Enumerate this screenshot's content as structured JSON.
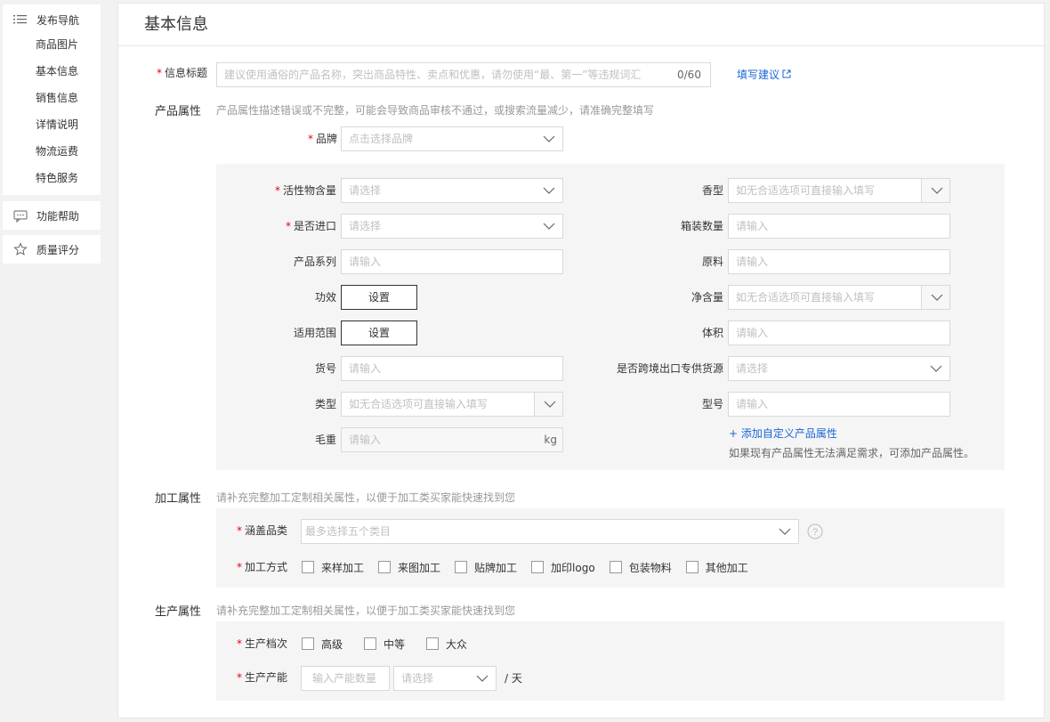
{
  "sidebar": {
    "head": "发布导航",
    "items": [
      "商品图片",
      "基本信息",
      "销售信息",
      "详情说明",
      "物流运费",
      "特色服务"
    ],
    "help": "功能帮助",
    "quality": "质量评分"
  },
  "main": {
    "title": "基本信息",
    "info_title": {
      "label": "信息标题",
      "placeholder": "建议使用通俗的产品名称，突出商品特性、卖点和优惠，请勿使用“最、第一”等违规词汇",
      "count": "0/60",
      "suggest": "填写建议"
    },
    "product_attr": {
      "title": "产品属性",
      "hint": "产品属性描述错误或不完整，可能会导致商品审核不通过，或搜索流量减少，请准确完整填写",
      "brand_label": "品牌",
      "brand_placeholder": "点击选择品牌",
      "left": {
        "active": {
          "label": "活性物含量",
          "placeholder": "请选择"
        },
        "import": {
          "label": "是否进口",
          "placeholder": "请选择"
        },
        "series": {
          "label": "产品系列",
          "placeholder": "请输入"
        },
        "effect": {
          "label": "功效",
          "button": "设置"
        },
        "scope": {
          "label": "适用范围",
          "button": "设置"
        },
        "item_no": {
          "label": "货号",
          "placeholder": "请输入"
        },
        "type": {
          "label": "类型",
          "placeholder": "如无合适选项可直接输入填写"
        },
        "gross": {
          "label": "毛重",
          "placeholder": "请输入",
          "unit": "kg"
        }
      },
      "right": {
        "fragrance": {
          "label": "香型",
          "placeholder": "如无合适选项可直接输入填写"
        },
        "box_qty": {
          "label": "箱装数量",
          "placeholder": "请输入"
        },
        "material": {
          "label": "原料",
          "placeholder": "请输入"
        },
        "net": {
          "label": "净含量",
          "placeholder": "如无合适选项可直接输入填写"
        },
        "volume": {
          "label": "体积",
          "placeholder": "请输入"
        },
        "cross_border": {
          "label": "是否跨境出口专供货源",
          "placeholder": "请选择"
        },
        "model": {
          "label": "型号",
          "placeholder": "请输入"
        },
        "add_custom": "+ 添加自定义产品属性",
        "add_hint": "如果现有产品属性无法满足需求，可添加产品属性。"
      }
    },
    "process_attr": {
      "title": "加工属性",
      "hint": "请补充完整加工定制相关属性，以便于加工类买家能快速找到您",
      "category_label": "涵盖品类",
      "category_placeholder": "最多选择五个类目",
      "method_label": "加工方式",
      "methods": [
        "来样加工",
        "来图加工",
        "贴牌加工",
        "加印logo",
        "包装物料",
        "其他加工"
      ]
    },
    "production_attr": {
      "title": "生产属性",
      "hint": "请补充完整加工定制相关属性，以便于加工类买家能快速找到您",
      "grade_label": "生产档次",
      "grades": [
        "高级",
        "中等",
        "大众"
      ],
      "capacity_label": "生产产能",
      "capacity_placeholder": "输入产能数量",
      "capacity_select": "请选择",
      "capacity_unit": "/ 天"
    }
  }
}
